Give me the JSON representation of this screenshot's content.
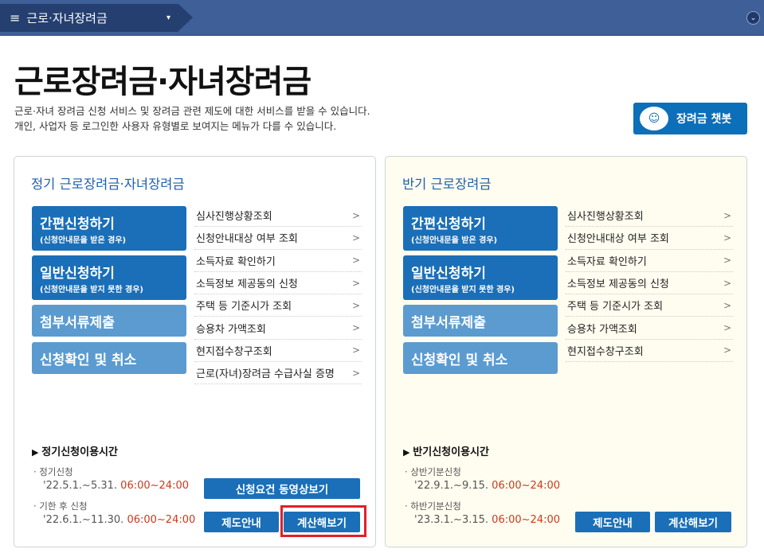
{
  "topbar": {
    "menu_label": "근로·자녀장려금",
    "menu_icon": "hamburger-icon",
    "caret": "▾",
    "right_icon": "chevron-down-icon"
  },
  "page": {
    "title": "근로장려금·자녀장려금",
    "desc1": "근로·자녀 장려금 신청 서비스 및 장려금 관련 제도에 대한 서비스를 받을 수 있습니다.",
    "desc2": "개인, 사업자 등 로그인한 사용자 유형별로 보여지는 메뉴가 다를 수 있습니다.",
    "chatbot_label": "장려금 챗봇"
  },
  "left": {
    "title": "정기 근로장려금·자녀장려금",
    "simple_apply": "간편신청하기",
    "simple_apply_sub": "(신청안내문을 받은 경우)",
    "general_apply": "일반신청하기",
    "general_apply_sub": "(신청안내문을 받지 못한 경우)",
    "attach": "첨부서류제출",
    "confirm": "신청확인 및 취소",
    "links": [
      "심사진행상황조회",
      "신청안내대상 여부 조회",
      "소득자료 확인하기",
      "소득정보 제공동의 신청",
      "주택 등 기준시가 조회",
      "승용차 가액조회",
      "현지접수창구조회",
      "근로(자녀)장려금 수급사실 증명"
    ],
    "sched_title": "정기신청이용시간",
    "s1_label": "· 정기신청",
    "s1_date": "'22.5.1.~5.31.",
    "s1_time": "06:00~24:00",
    "s2_label": "· 기한 후 신청",
    "s2_date": "'22.6.1.~11.30.",
    "s2_time": "06:00~24:00",
    "video_btn": "신청요건 동영상보기",
    "guide_btn": "제도안내",
    "calc_btn": "계산해보기"
  },
  "right": {
    "title": "반기 근로장려금",
    "simple_apply": "간편신청하기",
    "simple_apply_sub": "(신청안내문을 받은 경우)",
    "general_apply": "일반신청하기",
    "general_apply_sub": "(신청안내문을 받지 못한 경우)",
    "attach": "첨부서류제출",
    "confirm": "신청확인 및 취소",
    "links": [
      "심사진행상황조회",
      "신청안내대상 여부 조회",
      "소득자료 확인하기",
      "소득정보 제공동의 신청",
      "주택 등 기준시가 조회",
      "승용차 가액조회",
      "현지접수창구조회"
    ],
    "sched_title": "반기신청이용시간",
    "s1_label": "· 상반기분신청",
    "s1_date": "'22.9.1.~9.15.",
    "s1_time": "06:00~24:00",
    "s2_label": "· 하반기분신청",
    "s2_date": "'23.3.1.~3.15.",
    "s2_time": "06:00~24:00",
    "guide_btn": "제도안내",
    "calc_btn": "계산해보기"
  },
  "colors": {
    "accent": "#1a6fb8",
    "highlight": "#e0202a",
    "time": "#d0381a"
  }
}
